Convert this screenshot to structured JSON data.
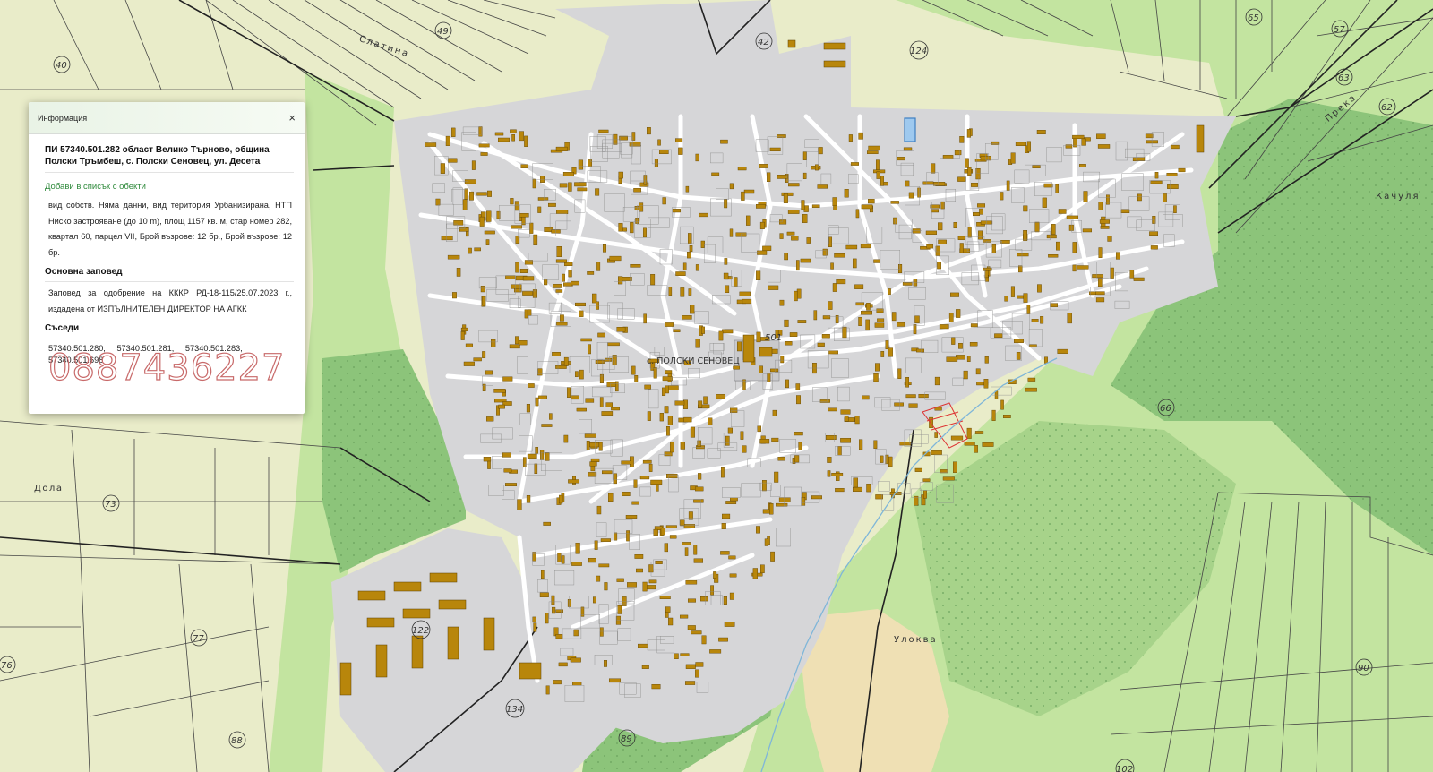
{
  "panel": {
    "title": "Информация",
    "close": "×",
    "parcel_title": "ПИ 57340.501.282 област Велико Търново, община Полски Тръмбеш, с. Полски Сеновец, ул. Десета",
    "add_link": "Добави в списък с обекти",
    "details": "вид собств. Няма данни, вид територия Урбанизирана, НТП Ниско застрояване (до 10 m), площ 1157 кв. м, стар номер 282, квартал 60, парцел VII, Брой възрове: 12 бр., Брой възрове: 12 бр.",
    "order_heading": "Основна заповед",
    "order_text": "Заповед за одобрение на КККР РД-18-115/25.07.2023 г., издадена от ИЗПЪЛНИТЕЛЕН ДИРЕКТОР НА АГКК",
    "neighbors_heading": "Съседи",
    "neighbors": [
      "57340.501.280,",
      "57340.501.281,",
      "57340.501.283,",
      "57340.501.698"
    ]
  },
  "watermark": "0887436227",
  "map": {
    "labels": {
      "slatina": "Слатина",
      "dola": "Дола",
      "kachulya": "Качуля",
      "preka": "Прека",
      "ulokva": "Улоква",
      "village": "с. ПОЛСКИ СЕНОВЕЦ",
      "parcel_center": "501"
    },
    "parcel_numbers": {
      "p40": "40",
      "p49": "49",
      "p42": "42",
      "p124": "124",
      "p65": "65",
      "p57": "57",
      "p63": "63",
      "p62": "62",
      "p73": "73",
      "p77": "77",
      "p76": "76",
      "p88": "88",
      "p122": "122",
      "p134": "134",
      "p89": "89",
      "p66": "66",
      "p90": "90",
      "p102": "102"
    }
  },
  "colors": {
    "fields": "#e9ecc9",
    "light_green": "#c3e4a0",
    "forest": "#8cc47a",
    "urban": "#d6d6d8",
    "building": "#b8860b",
    "street": "#ffffff",
    "sand": "#efe0b4",
    "highlight": "#9ec9ef",
    "link": "#2f8a3c"
  }
}
